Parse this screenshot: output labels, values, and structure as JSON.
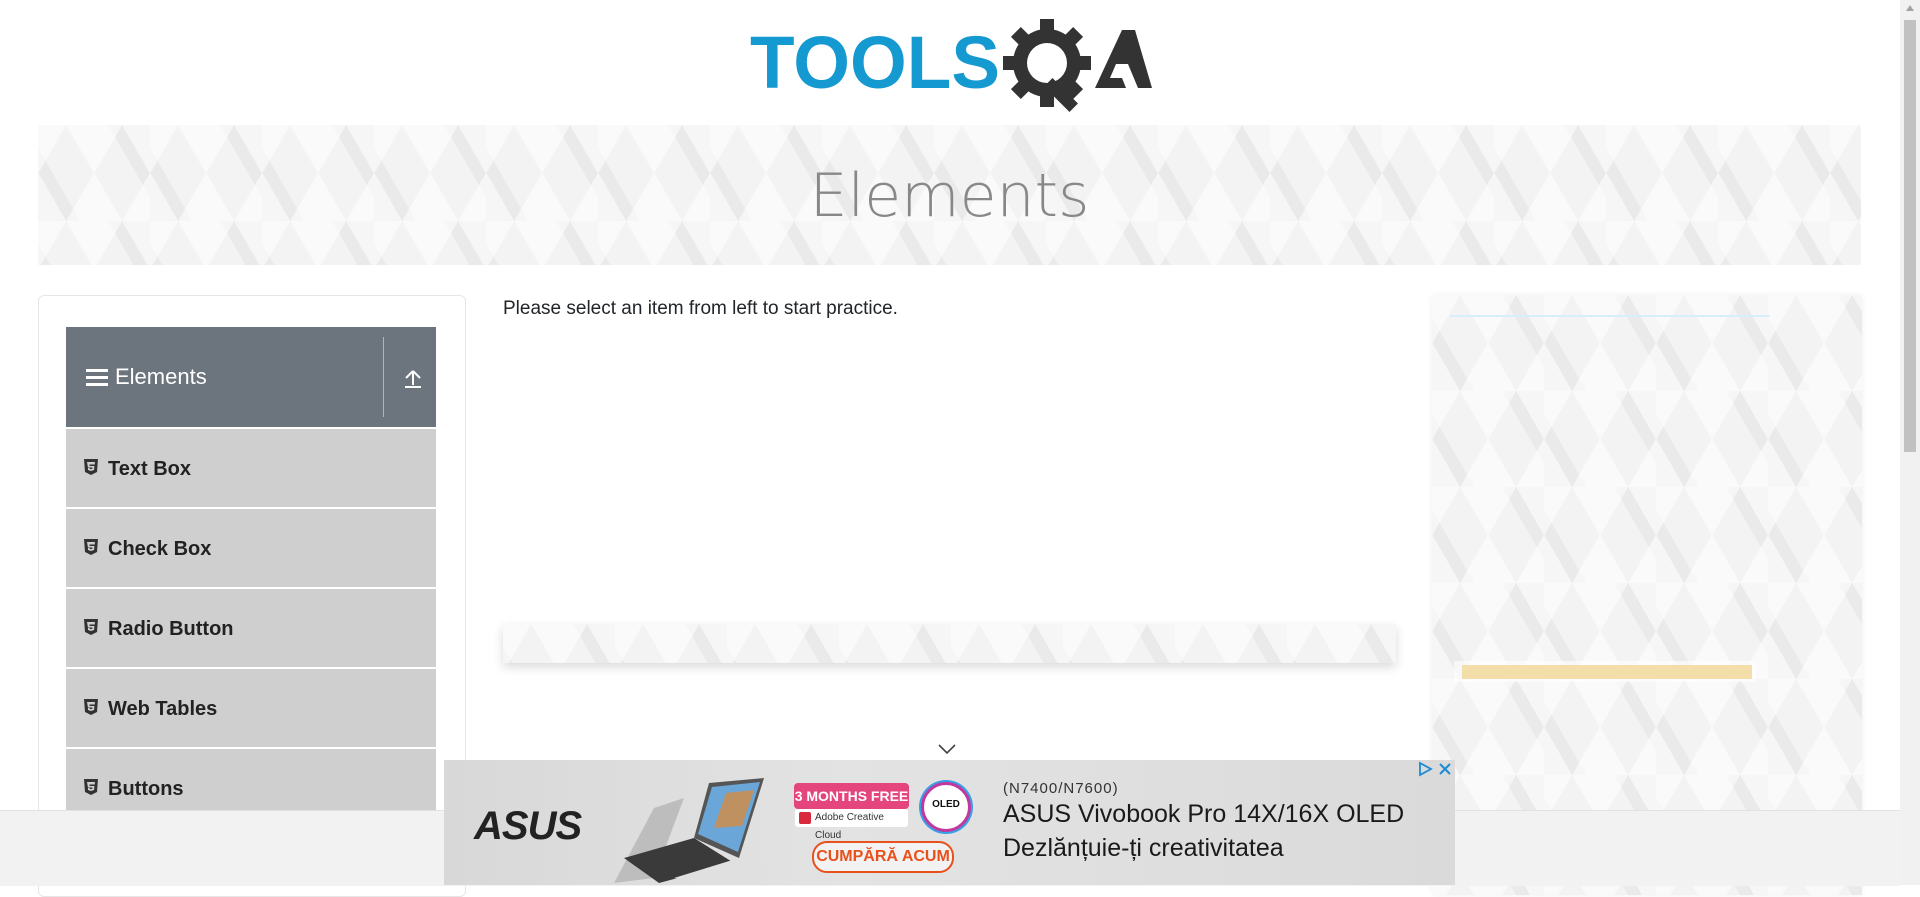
{
  "logo": {
    "text_tools": "TOOLS",
    "text_qa": "QA",
    "colors": {
      "tools": "#1599d1",
      "gear": "#333333"
    }
  },
  "banner": {
    "title": "Elements"
  },
  "sidebar": {
    "group_title": "Elements",
    "items": [
      {
        "label": "Text Box",
        "icon": "html5-icon"
      },
      {
        "label": "Check Box",
        "icon": "html5-icon"
      },
      {
        "label": "Radio Button",
        "icon": "html5-icon"
      },
      {
        "label": "Web Tables",
        "icon": "html5-icon"
      },
      {
        "label": "Buttons",
        "icon": "html5-icon"
      }
    ]
  },
  "main": {
    "instruction": "Please select an item from left to start practice."
  },
  "ad": {
    "brand": "ASUS",
    "promo_months": "3 MONTHS FREE",
    "promo_adobe": "Adobe Creative Cloud",
    "badge": "OLED",
    "cta": "CUMPĂRĂ ACUM",
    "model": "(N7400/N7600)",
    "title": "ASUS Vivobook Pro 14X/16X OLED",
    "tagline": "Dezlănțuie-ți creativitatea"
  }
}
